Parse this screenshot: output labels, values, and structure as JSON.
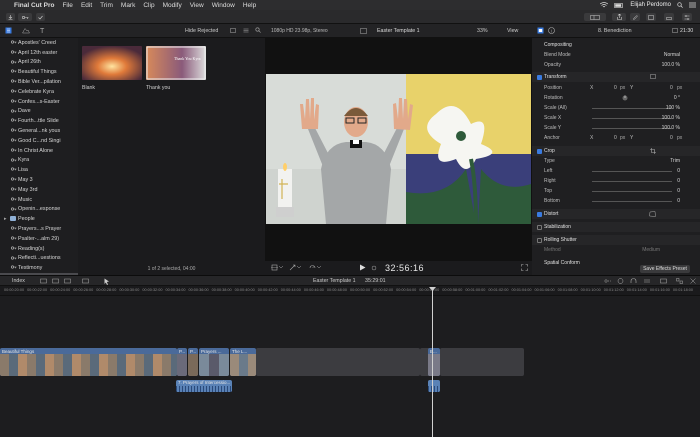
{
  "menubar": {
    "app": "Final Cut Pro",
    "items": [
      "File",
      "Edit",
      "Trim",
      "Mark",
      "Clip",
      "Modify",
      "View",
      "Window",
      "Help"
    ],
    "user": "Elijah Perdomo"
  },
  "browser": {
    "filter": "Hide Rejected",
    "items": [
      {
        "label": "Apostles' Creed",
        "type": "keyword"
      },
      {
        "label": "April 12th easter",
        "type": "keyword"
      },
      {
        "label": "April 26th",
        "type": "keyword"
      },
      {
        "label": "Beautiful Things",
        "type": "keyword"
      },
      {
        "label": "Bible Ver...pilation",
        "type": "keyword"
      },
      {
        "label": "Celebrate Kyra",
        "type": "keyword"
      },
      {
        "label": "Confes...s-Easter",
        "type": "keyword"
      },
      {
        "label": "Dave",
        "type": "keyword"
      },
      {
        "label": "Fourth...ttle Slide",
        "type": "keyword"
      },
      {
        "label": "General...nk yous",
        "type": "keyword"
      },
      {
        "label": "Good C...nd Singi",
        "type": "keyword"
      },
      {
        "label": "In Christ Alone",
        "type": "keyword"
      },
      {
        "label": "Kyra",
        "type": "keyword"
      },
      {
        "label": "Lisa",
        "type": "keyword"
      },
      {
        "label": "May 3",
        "type": "keyword"
      },
      {
        "label": "May 3rd",
        "type": "keyword"
      },
      {
        "label": "Music",
        "type": "keyword"
      },
      {
        "label": "Openin...esponse",
        "type": "keyword"
      },
      {
        "label": "People",
        "type": "folder"
      },
      {
        "label": "Prayers...s Prayer",
        "type": "keyword"
      },
      {
        "label": "Psalter-...alm 29)",
        "type": "keyword"
      },
      {
        "label": "Reading(s)",
        "type": "keyword"
      },
      {
        "label": "Reflecti...uestions",
        "type": "keyword"
      },
      {
        "label": "Testimony",
        "type": "keyword"
      },
      {
        "label": "Thank You Kyra",
        "type": "keyword",
        "selected": true
      }
    ],
    "clips": [
      {
        "label": "Blank"
      },
      {
        "label": "Thank you",
        "thumb_text": "Thank You Kyra"
      }
    ],
    "status": "1 of 2 selected, 04:00"
  },
  "viewer": {
    "format": "1080p HD 23.98p, Stereo",
    "project": "Easter Template 1",
    "zoom": "33%",
    "view_label": "View",
    "timecode": "32:56:16"
  },
  "inspector": {
    "title": "8. Benediction",
    "duration": "21:30",
    "compositing_label": "Compositing",
    "blend_mode_label": "Blend Mode",
    "blend_mode": "Normal",
    "opacity_label": "Opacity",
    "opacity": "100.0 %",
    "transform_label": "Transform",
    "position_label": "Position",
    "pos_x_label": "X",
    "pos_x": "0",
    "pos_x_unit": "px",
    "pos_y_label": "Y",
    "pos_y": "0",
    "pos_y_unit": "px",
    "rotation_label": "Rotation",
    "rotation": "0 °",
    "scale_all_label": "Scale (All)",
    "scale_all": "100 %",
    "scale_x_label": "Scale X",
    "scale_x": "100.0 %",
    "scale_y_label": "Scale Y",
    "scale_y": "100.0 %",
    "anchor_label": "Anchor",
    "anchor_x_label": "X",
    "anchor_x": "0",
    "anchor_x_unit": "px",
    "anchor_y_label": "Y",
    "anchor_y": "0",
    "anchor_y_unit": "px",
    "crop_label": "Crop",
    "crop_type_label": "Type",
    "crop_type": "Trim",
    "left_label": "Left",
    "left": "0",
    "right_label": "Right",
    "right": "0",
    "top_label": "Top",
    "top": "0",
    "bottom_label": "Bottom",
    "bottom": "0",
    "distort_label": "Distort",
    "stabilization_label": "Stabilization",
    "rolling_shutter_label": "Rolling Shutter",
    "method_label": "Method",
    "method": "Medium",
    "spatial_label": "Spatial Conform",
    "save_preset": "Save Effects Preset"
  },
  "timeline": {
    "index_label": "Index",
    "project": "Easter Template 1",
    "duration": "35:29:01",
    "ruler": [
      "00:00:20:00",
      "00:00:22:00",
      "00:00:24:00",
      "00:00:26:00",
      "00:00:28:00",
      "00:00:30:00",
      "00:00:32:00",
      "00:00:34:00",
      "00:00:36:00",
      "00:00:38:00",
      "00:00:40:00",
      "00:00:42:00",
      "00:00:44:00",
      "00:00:46:00",
      "00:00:48:00",
      "00:00:50:00",
      "00:00:52:00",
      "00:00:54:00",
      "00:00:56:00",
      "00:00:58:00",
      "00:01:00:00",
      "00:01:02:00",
      "00:01:04:00",
      "00:01:06:00",
      "00:01:08:00",
      "00:01:10:00",
      "00:01:12:00",
      "00:01:14:00",
      "00:01:16:00",
      "00:01:18:00"
    ],
    "clips": [
      {
        "label": "Beautiful Things"
      },
      {
        "label": "P..."
      },
      {
        "label": "P..."
      },
      {
        "label": "Prayers ..."
      },
      {
        "label": "The L..."
      },
      {
        "label": "B..."
      }
    ],
    "connected_clip": "7. Prayers of Intercessio..."
  },
  "colors": {
    "accent": "#3a7be0",
    "clip_blue": "#4a6a9a",
    "audio_blue": "#5a82b6"
  }
}
